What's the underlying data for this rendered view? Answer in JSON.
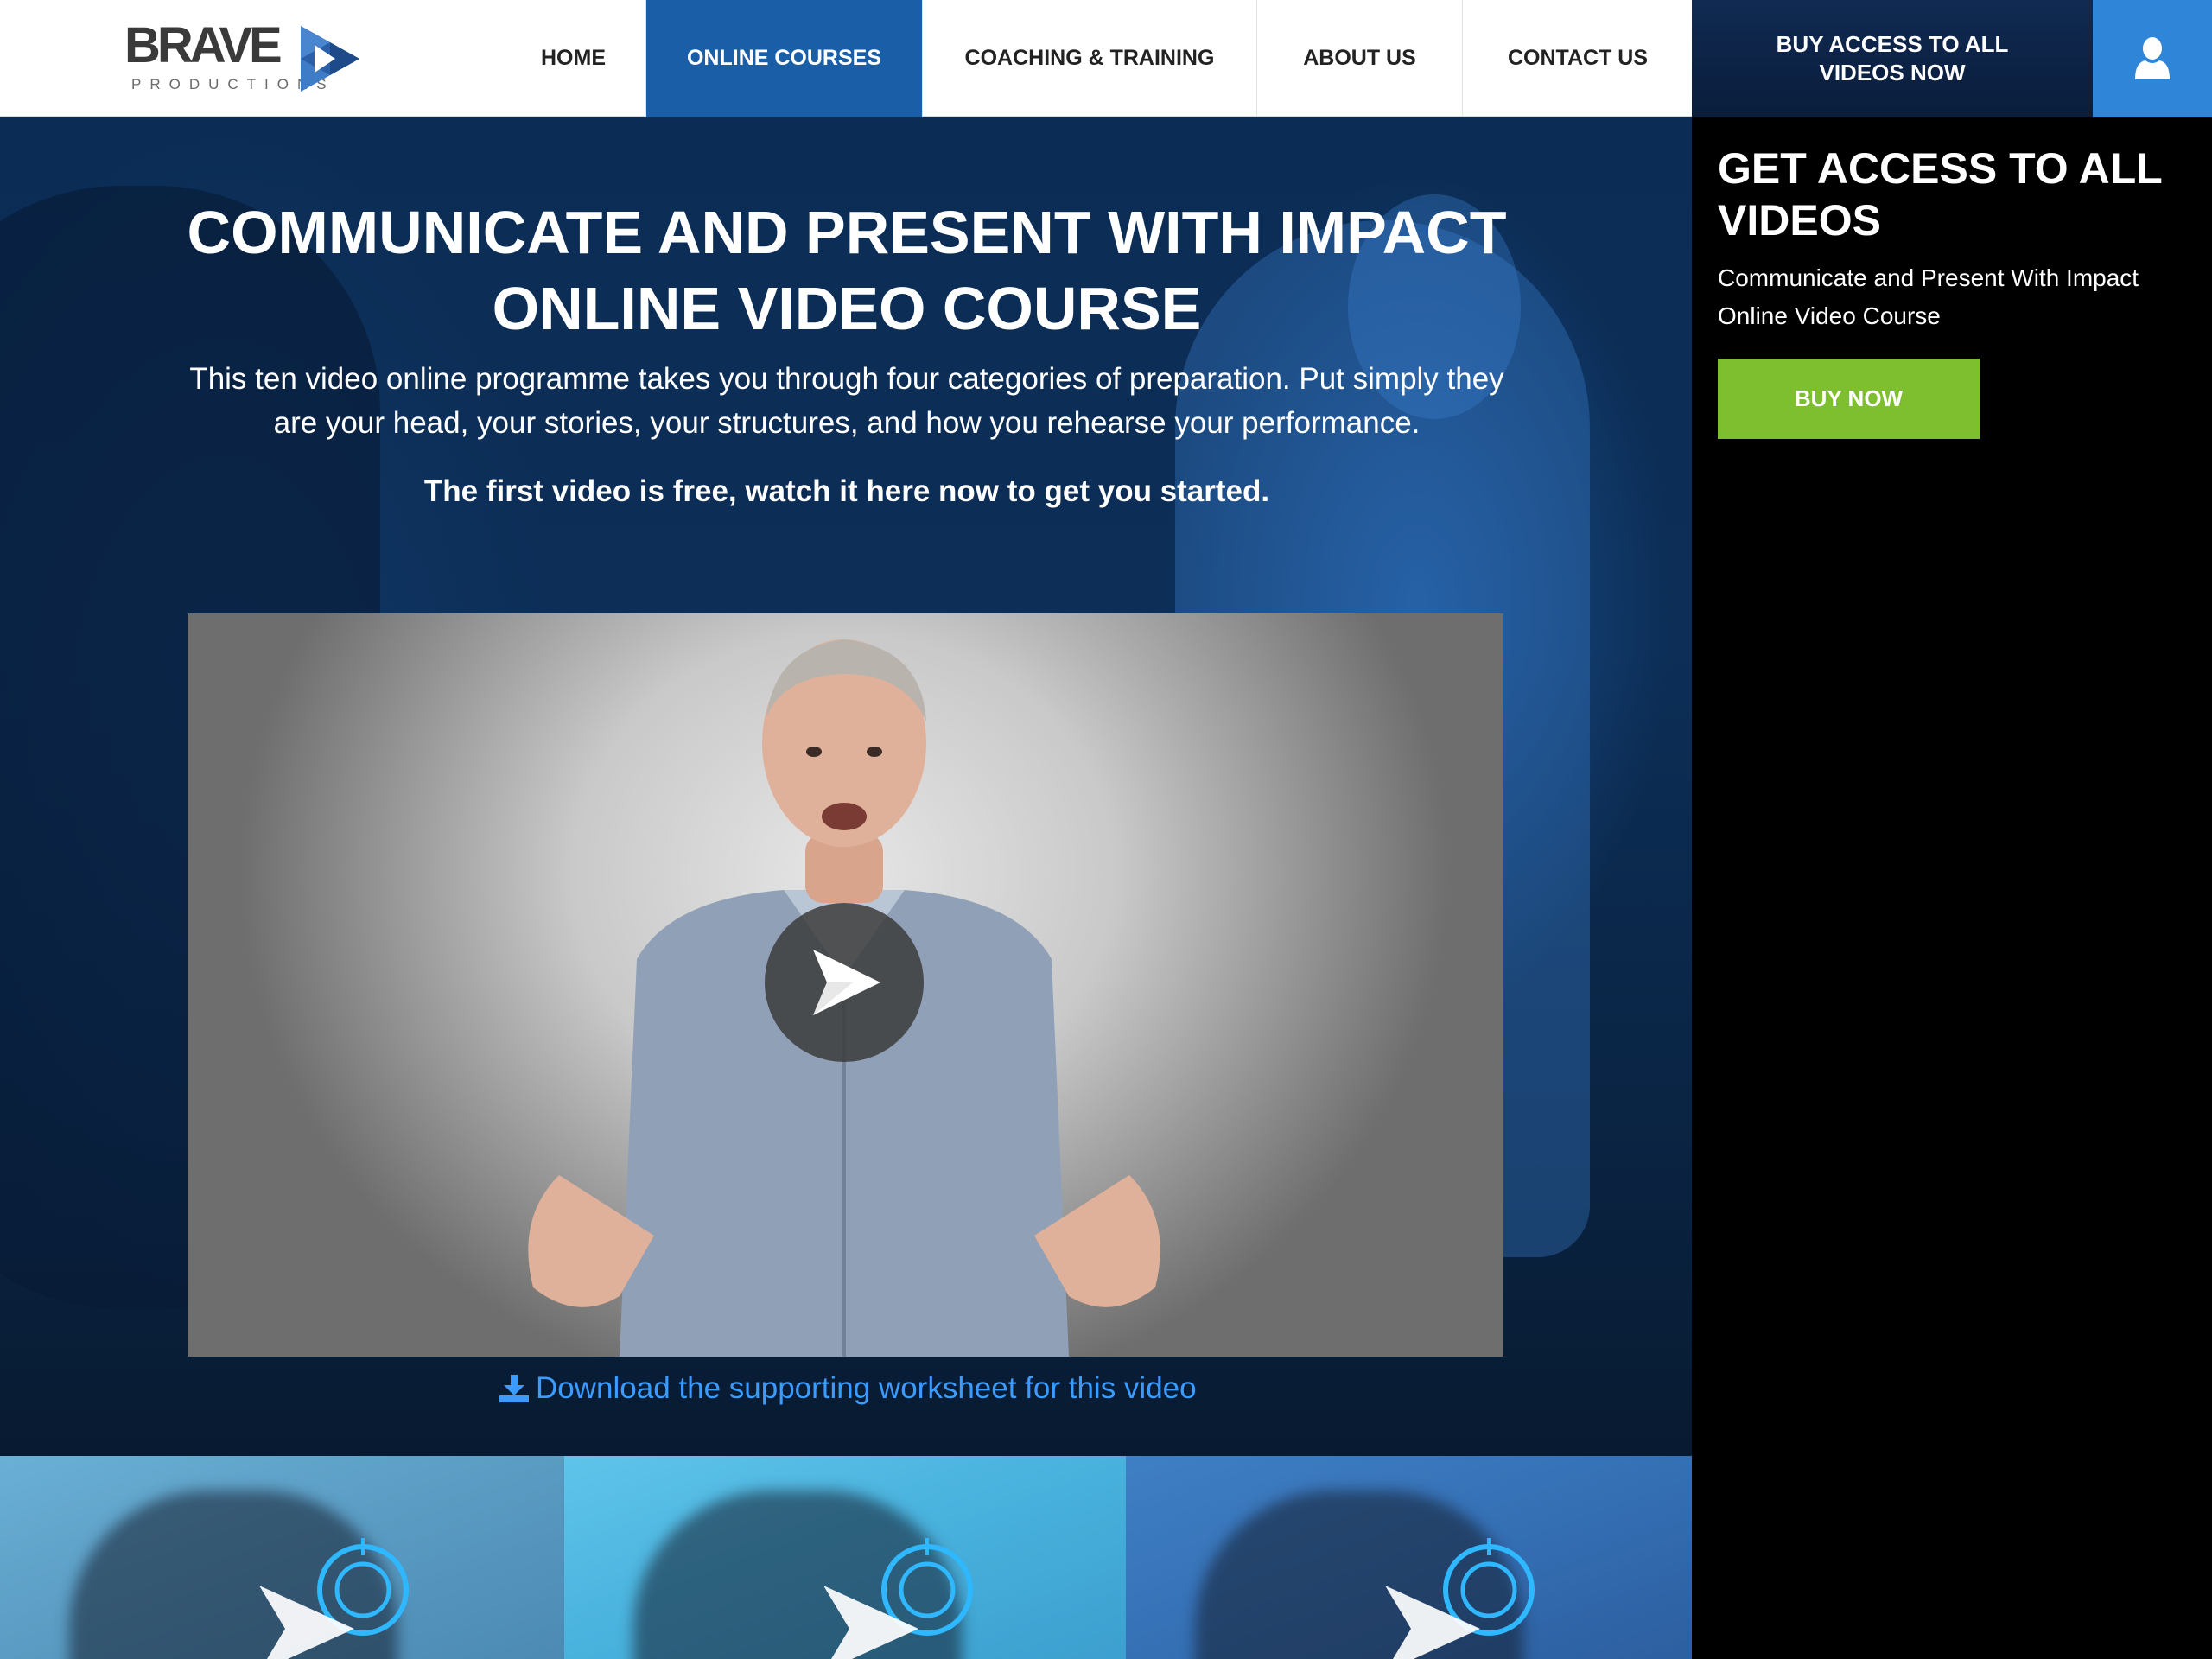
{
  "brand": {
    "name": "BRAVE",
    "sub": "PRODUCTIONS",
    "accent": "#3a76c4"
  },
  "nav": {
    "items": [
      {
        "label": "HOME",
        "active": false
      },
      {
        "label": "ONLINE COURSES",
        "active": true
      },
      {
        "label": "COACHING & TRAINING",
        "active": false
      },
      {
        "label": "ABOUT US",
        "active": false
      },
      {
        "label": "CONTACT US",
        "active": false
      }
    ],
    "buy_access_label": "BUY ACCESS TO ALL VIDEOS NOW",
    "user_icon": "user-icon"
  },
  "hero": {
    "title_line1": "COMMUNICATE AND PRESENT WITH IMPACT",
    "title_line2": "ONLINE VIDEO COURSE",
    "description": "This ten video online programme takes you through four categories of preparation. Put simply they are your head, your stories, your structures, and how you rehearse your performance.",
    "free_note": "The first video is free, watch it here now to get you started.",
    "download_label": "Download the supporting worksheet for this video"
  },
  "sidebar": {
    "title": "GET ACCESS TO ALL VIDEOS",
    "subtitle": "Communicate and Present With Impact Online Video Course",
    "button_label": "BUY NOW"
  },
  "colors": {
    "nav_active": "#1a5ea8",
    "buy_access_bg": "#0f2a52",
    "user_btn": "#2f86d8",
    "buy_now": "#7dbf2e",
    "link": "#3b9bff"
  }
}
